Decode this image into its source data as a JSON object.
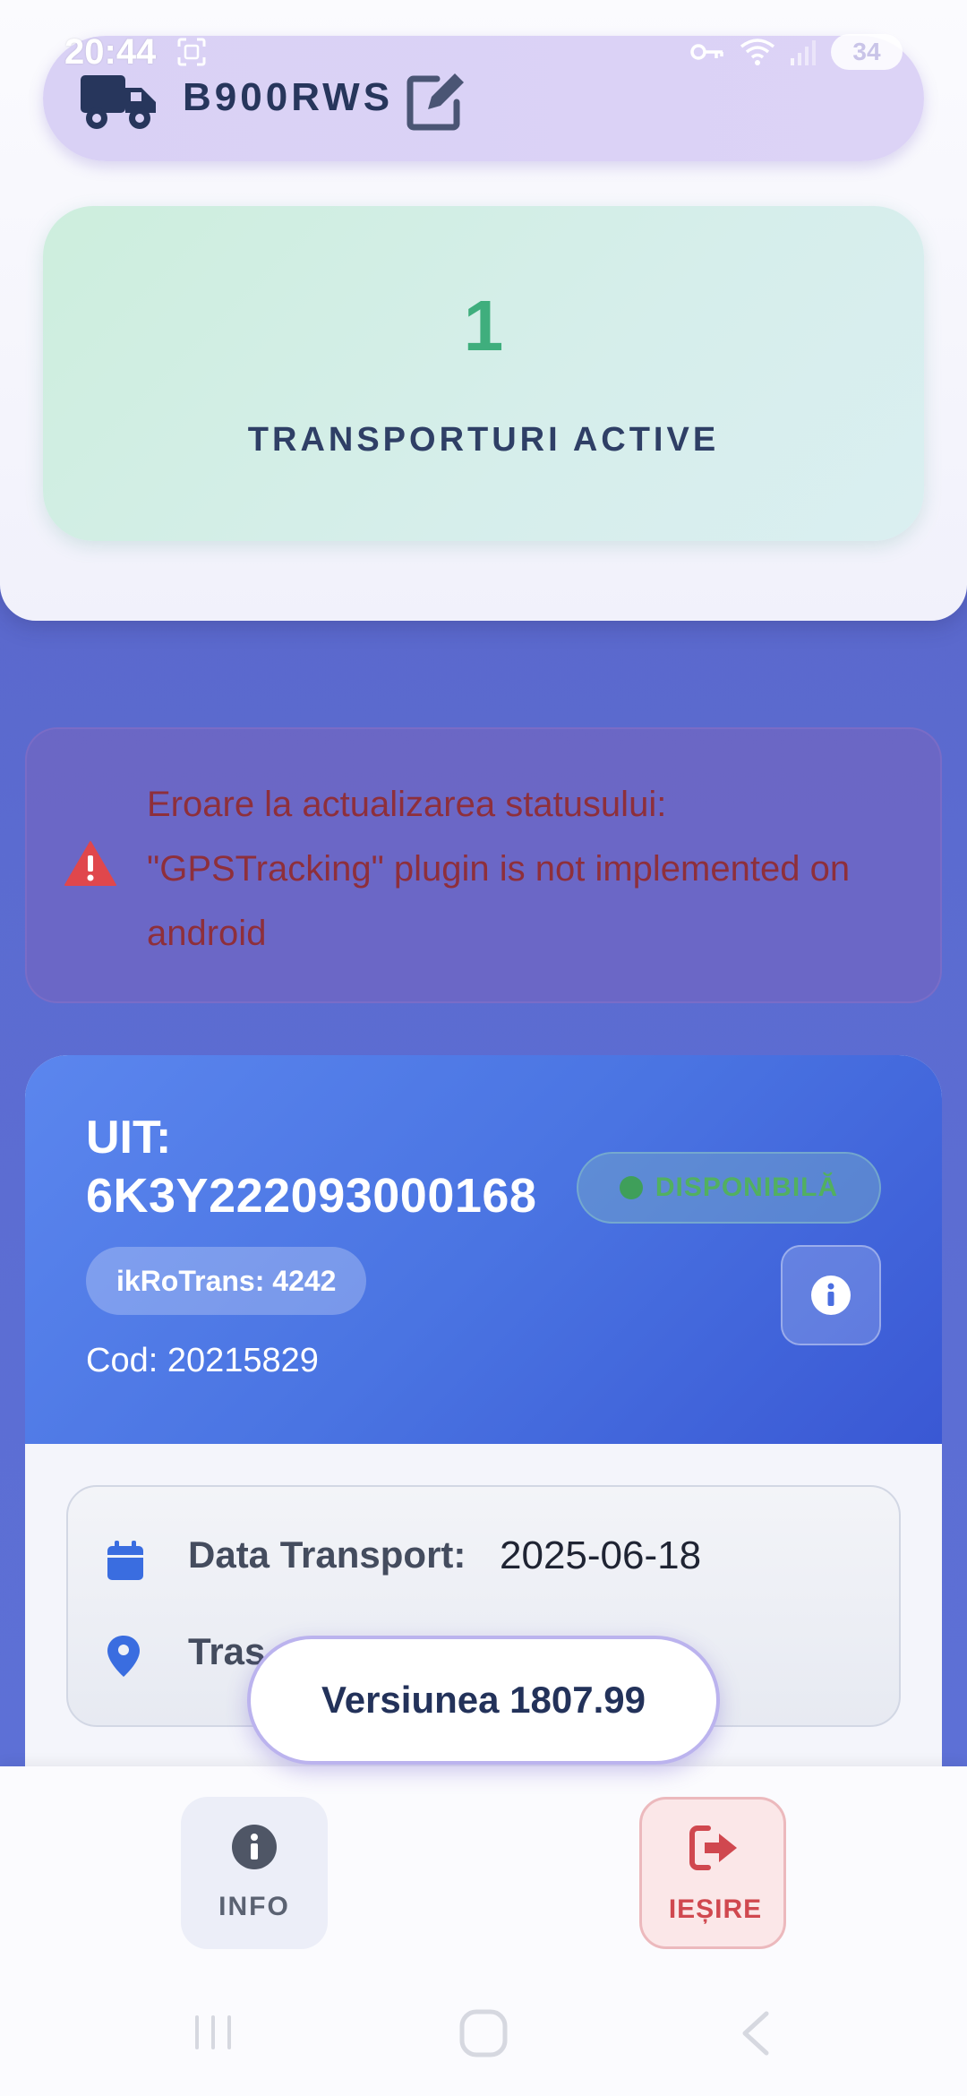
{
  "status_bar": {
    "time": "20:44",
    "battery": "34"
  },
  "header": {
    "plate": "B900RWS",
    "active_count": "1",
    "active_label": "TRANSPORTURI ACTIVE"
  },
  "error": {
    "message": "Eroare la actualizarea statusului: \"GPSTracking\" plugin is not implemented on android"
  },
  "transport": {
    "uit_label": "UIT:",
    "uit_value": "6K3Y222093000168",
    "status": "DISPONIBILĂ",
    "ikrotrans": "ikRoTrans: 4242",
    "cod": "Cod: 20215829",
    "date_label": "Data Transport:",
    "date_value": "2025-06-18",
    "route_label": "Tras"
  },
  "version": "Versiunea 1807.99",
  "bottom_nav": {
    "info_label": "INFO",
    "exit_label": "IEȘIRE"
  },
  "colors": {
    "accent_green": "#3fae7d",
    "header_blue": "#4a74e2",
    "error_text": "#8e2f3b",
    "exit_red": "#d0484f"
  },
  "icons": [
    "truck-icon",
    "edit-icon",
    "warning-icon",
    "info-icon",
    "calendar-icon",
    "location-pin-icon",
    "logout-icon",
    "key-icon",
    "wifi-icon",
    "signal-icon",
    "screenshot-icon"
  ]
}
